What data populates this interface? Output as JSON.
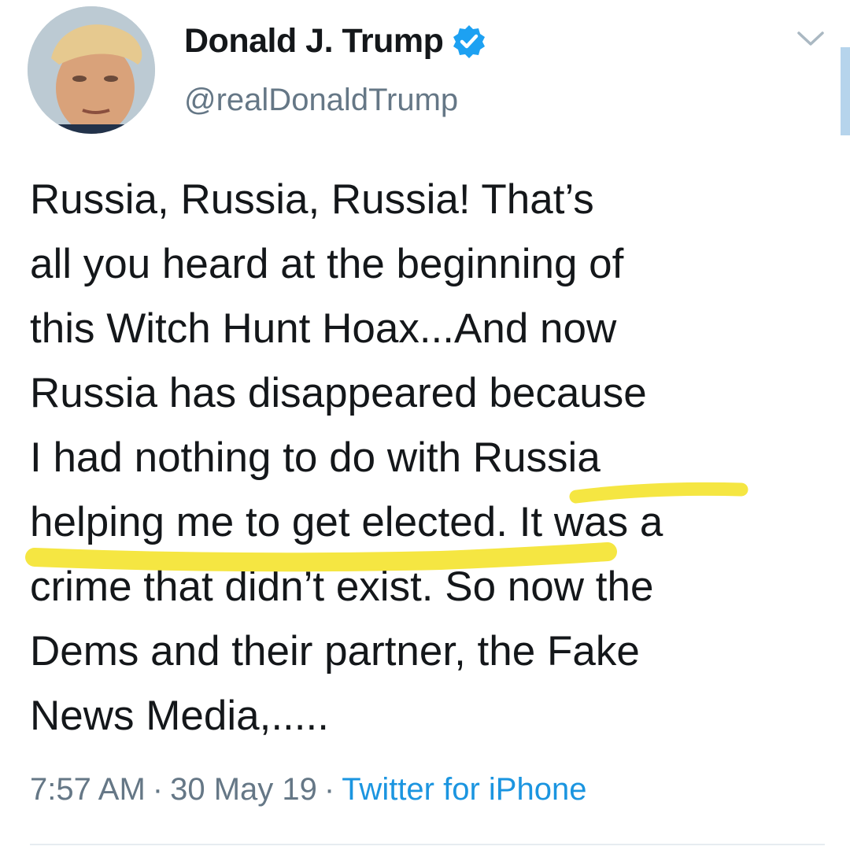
{
  "author": {
    "display_name": "Donald J. Trump",
    "handle": "@realDonaldTrump",
    "verified": true
  },
  "tweet": {
    "lines": [
      "Russia, Russia, Russia! That’s",
      "all you heard at the beginning of",
      "this Witch Hunt Hoax...And now",
      "Russia has disappeared because",
      "I had nothing to do with Russia",
      "helping me to get elected. It was a",
      "crime that didn’t exist. So now the",
      "Dems and their partner, the Fake",
      "News Media,....."
    ]
  },
  "meta": {
    "time": "7:57 AM",
    "separator": "·",
    "date": "30 May 19",
    "source": "Twitter for iPhone"
  },
  "icons": {
    "avatar": "avatar-photo",
    "verified": "verified-badge-icon",
    "menu": "chevron-down-icon"
  },
  "colors": {
    "text": "#14171a",
    "secondary": "#657786",
    "link": "#1b95e0",
    "verified": "#1da1f2",
    "highlight": "#f5e642"
  }
}
